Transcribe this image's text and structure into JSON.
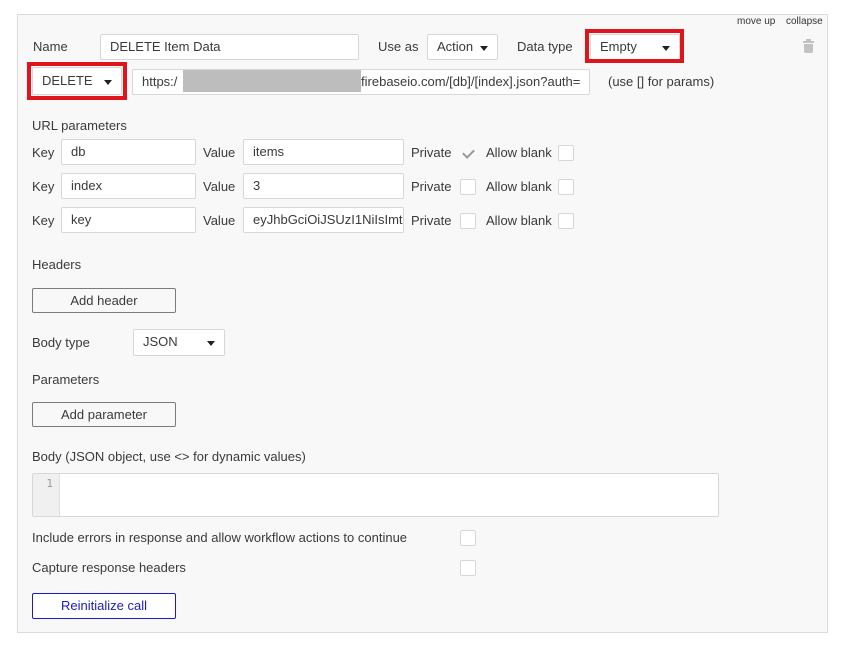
{
  "top_links": {
    "move_up": "move up",
    "collapse": "collapse"
  },
  "call": {
    "name_label": "Name",
    "name_value": "DELETE Item Data",
    "use_as_label": "Use as",
    "use_as_value": "Action",
    "data_type_label": "Data type",
    "data_type_value": "Empty",
    "method_value": "DELETE",
    "url_prefix": "https:/",
    "url_suffix": ".firebaseio.com/[db]/[index].json?auth=",
    "url_hint": "(use [] for params)"
  },
  "url_parameters": {
    "title": "URL parameters",
    "key_label": "Key",
    "value_label": "Value",
    "private_label": "Private",
    "allow_blank_label": "Allow blank",
    "rows": [
      {
        "key": "db",
        "value": "items",
        "private": true,
        "allow_blank": false
      },
      {
        "key": "index",
        "value": "3",
        "private": false,
        "allow_blank": false
      },
      {
        "key": "key",
        "value": "eyJhbGciOiJSUzI1NiIsImtp",
        "private": false,
        "allow_blank": false
      }
    ]
  },
  "headers": {
    "title": "Headers",
    "add_label": "Add header"
  },
  "body_type": {
    "label": "Body type",
    "value": "JSON"
  },
  "parameters": {
    "title": "Parameters",
    "add_label": "Add parameter"
  },
  "body": {
    "label": "Body (JSON object, use <> for dynamic values)",
    "line_number": "1",
    "content": ""
  },
  "options": {
    "include_errors_label": "Include errors in response and allow workflow actions to continue",
    "include_errors": false,
    "capture_headers_label": "Capture response headers",
    "capture_headers": false
  },
  "reinitialize_label": "Reinitialize call",
  "colors": {
    "highlight": "#e0141c",
    "primary": "#1a1ad0",
    "panel_bg": "#f8f8f8"
  },
  "icons": {
    "delete": "trash-icon",
    "dropdown": "caret-down-icon",
    "checked": "checkmark-icon"
  }
}
